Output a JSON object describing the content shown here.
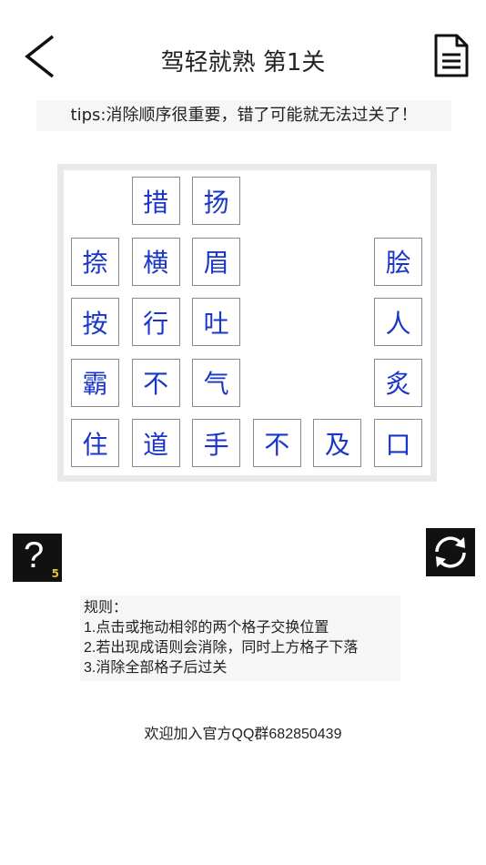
{
  "header": {
    "title": "驾轻就熟 第1关"
  },
  "tips": "tips:消除顺序很重要，错了可能就无法过关了！",
  "board": {
    "tiles": [
      {
        "row": 0,
        "col": 1,
        "char": "措"
      },
      {
        "row": 0,
        "col": 2,
        "char": "扬"
      },
      {
        "row": 1,
        "col": 0,
        "char": "捺"
      },
      {
        "row": 1,
        "col": 1,
        "char": "横"
      },
      {
        "row": 1,
        "col": 2,
        "char": "眉"
      },
      {
        "row": 1,
        "col": 5,
        "char": "脍"
      },
      {
        "row": 2,
        "col": 0,
        "char": "按"
      },
      {
        "row": 2,
        "col": 1,
        "char": "行"
      },
      {
        "row": 2,
        "col": 2,
        "char": "吐"
      },
      {
        "row": 2,
        "col": 5,
        "char": "人"
      },
      {
        "row": 3,
        "col": 0,
        "char": "霸"
      },
      {
        "row": 3,
        "col": 1,
        "char": "不"
      },
      {
        "row": 3,
        "col": 2,
        "char": "气"
      },
      {
        "row": 3,
        "col": 5,
        "char": "炙"
      },
      {
        "row": 4,
        "col": 0,
        "char": "住"
      },
      {
        "row": 4,
        "col": 1,
        "char": "道"
      },
      {
        "row": 4,
        "col": 2,
        "char": "手"
      },
      {
        "row": 4,
        "col": 3,
        "char": "不"
      },
      {
        "row": 4,
        "col": 4,
        "char": "及"
      },
      {
        "row": 4,
        "col": 5,
        "char": "口"
      }
    ]
  },
  "hint": {
    "symbol": "?",
    "count": "5"
  },
  "rules": {
    "heading": "规则：",
    "lines": [
      "1.点击或拖动相邻的两个格子交换位置",
      "2.若出现成语则会消除，同时上方格子下落",
      "3.消除全部格子后过关"
    ]
  },
  "footer": "欢迎加入官方QQ群682850439",
  "colors": {
    "tile_text": "#1a36c9",
    "button_bg": "#111111",
    "hint_count": "#e8c23a"
  }
}
